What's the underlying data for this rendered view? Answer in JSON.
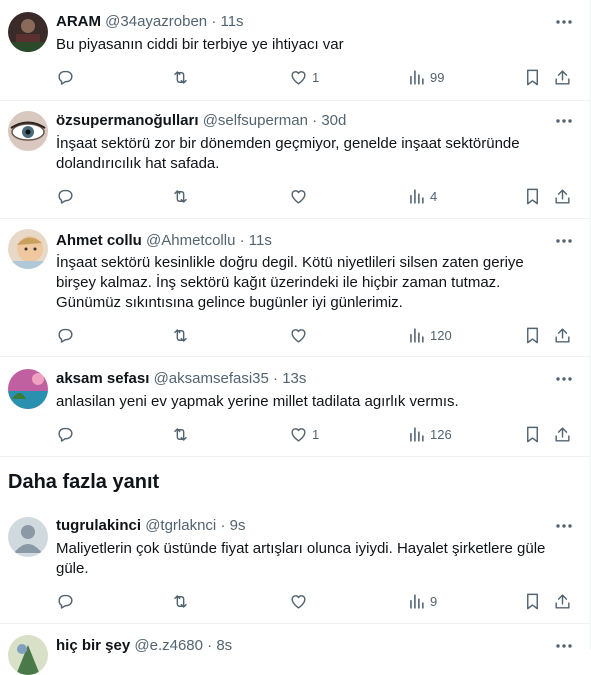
{
  "section_title": "Daha fazla yanıt",
  "tweets": [
    {
      "name": "ARAM",
      "handle": "@34ayazroben",
      "time": "11s",
      "text": "Bu piyasanın ciddi bir terbiye ye ihtiyacı var",
      "likes": "1",
      "views": "99",
      "replies": "",
      "retweets": "",
      "avatar": "dark"
    },
    {
      "name": "özsupermanoğulları",
      "handle": "@selfsuperman",
      "time": "30d",
      "text": "İnşaat sektörü zor bir dönemden geçmiyor,  genelde inşaat sektöründe dolandırıcılık hat safada.",
      "likes": "",
      "views": "4",
      "replies": "",
      "retweets": "",
      "avatar": "eye"
    },
    {
      "name": "Ahmet collu",
      "handle": "@Ahmetcollu",
      "time": "11s",
      "text": "İnşaat sektörü kesinlikle doğru degil. Kötü niyetlileri silsen zaten geriye birşey kalmaz. İnş sektörü kağıt üzerindeki ile hiçbir zaman tutmaz. Günümüz sıkıntısına gelince bugünler iyi günlerimiz.",
      "likes": "",
      "views": "120",
      "replies": "",
      "retweets": "",
      "avatar": "baby"
    },
    {
      "name": "aksam sefası",
      "handle": "@aksamsefasi35",
      "time": "13s",
      "text": "anlasilan yeni ev yapmak yerine millet tadilata agırlık vermıs.",
      "likes": "1",
      "views": "126",
      "replies": "",
      "retweets": "",
      "avatar": "beach"
    },
    {
      "name": "tugrulakinci",
      "handle": "@tgrlaknci",
      "time": "9s",
      "text": "Maliyetlerin çok üstünde fiyat artışları olunca iyiydi. Hayalet şirketlere güle güle.",
      "likes": "",
      "views": "9",
      "replies": "",
      "retweets": "",
      "avatar": "default"
    },
    {
      "name": "hiç bir şey",
      "handle": "@e.z4680",
      "time": "8s",
      "text": "",
      "likes": "",
      "views": "",
      "replies": "",
      "retweets": "",
      "avatar": "partial"
    }
  ]
}
